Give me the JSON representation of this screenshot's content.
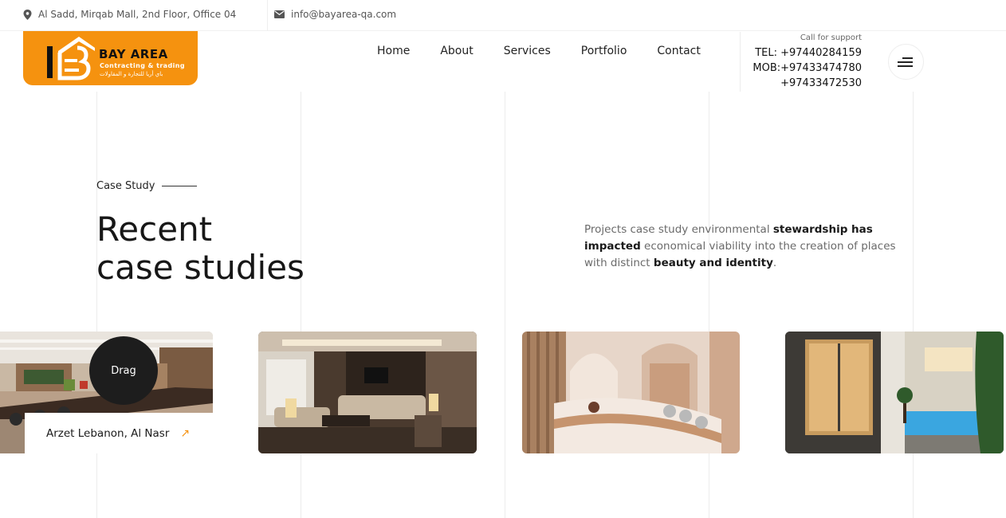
{
  "topbar": {
    "address": "Al Sadd, Mirqab Mall, 2nd Floor, Office 04",
    "email": "info@bayarea-qa.com"
  },
  "logo": {
    "brand": "BAY AREA",
    "tagline": "Contracting & trading",
    "tagline_ar": "باي أريا للتجارة و المقاولات"
  },
  "nav": {
    "items": [
      {
        "label": "Home"
      },
      {
        "label": "About"
      },
      {
        "label": "Services"
      },
      {
        "label": "Portfolio"
      },
      {
        "label": "Contact"
      }
    ]
  },
  "support": {
    "label": "Call for support",
    "tel": "TEL: +97440284159",
    "mob1": "MOB:+97433474780",
    "mob2": "+97433472530"
  },
  "section": {
    "eyebrow": "Case Study",
    "headline_line1": "Recent",
    "headline_line2": "case studies",
    "desc_part1": "Projects case study environmental ",
    "desc_bold1": "stewardship has impacted",
    "desc_part2": " economical viability into the creation of places with distinct ",
    "desc_bold2": "beauty and identity",
    "desc_part3": "."
  },
  "cards": {
    "drag_label": "Drag",
    "first_caption": "Arzet Lebanon, Al Nasr",
    "arrow_icon": "arrow-up-right-icon"
  },
  "colors": {
    "accent": "#f5920f",
    "dark": "#1d1d1d"
  }
}
